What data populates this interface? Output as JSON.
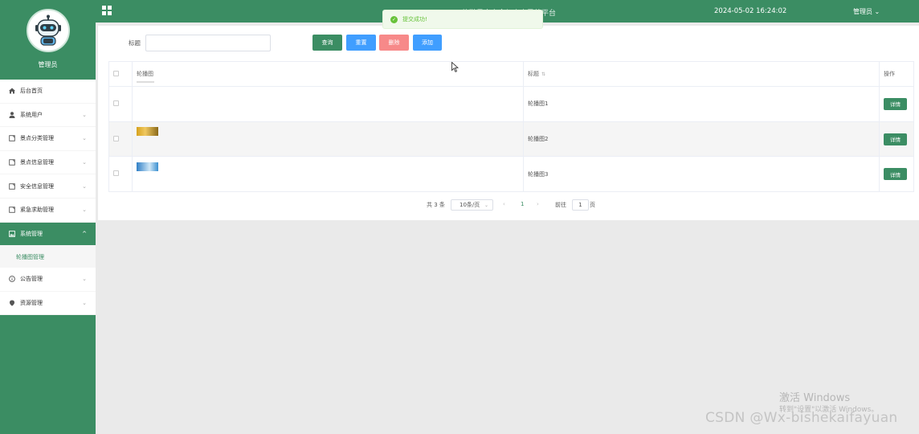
{
  "sidebar": {
    "role": "管理员",
    "items": [
      {
        "label": "后台首页",
        "icon": "home-icon",
        "active": false
      },
      {
        "label": "系统用户",
        "icon": "user-icon",
        "active": false
      },
      {
        "label": "景点分类管理",
        "icon": "doc-icon",
        "active": false
      },
      {
        "label": "景点信息管理",
        "icon": "doc-icon",
        "active": false
      },
      {
        "label": "安全信息管理",
        "icon": "doc-icon",
        "active": false
      },
      {
        "label": "紧急求助管理",
        "icon": "doc-icon",
        "active": false
      },
      {
        "label": "系统管理",
        "icon": "picture-icon",
        "active": true
      },
      {
        "label": "公告管理",
        "icon": "info-icon",
        "active": false
      },
      {
        "label": "资源管理",
        "icon": "location-icon",
        "active": false
      }
    ],
    "submenu": {
      "label": "轮播图管理"
    }
  },
  "header": {
    "title": "旅游景点安全与个人导航平台",
    "datetime": "2024-05-02 16:24:02",
    "user": "管理员"
  },
  "toast": {
    "message": "提交成功!"
  },
  "search": {
    "label": "标题",
    "placeholder": ""
  },
  "toolbar": {
    "query": "查询",
    "reset": "重置",
    "delete": "删除",
    "add": "添加"
  },
  "table": {
    "headers": {
      "image": "轮播图",
      "title": "标题",
      "action": "操作"
    },
    "rows": [
      {
        "title": "轮播图1",
        "action": "详情"
      },
      {
        "title": "轮播图2",
        "action": "详情"
      },
      {
        "title": "轮播图3",
        "action": "详情"
      }
    ]
  },
  "pagination": {
    "total": "共 3 条",
    "page_size": "10条/页",
    "current": "1",
    "goto_label": "前往",
    "goto_value": "1",
    "page_suffix": "页"
  },
  "watermark": {
    "activate_title": "激活 Windows",
    "activate_hint": "转到\"设置\"以激活 Windows。",
    "csdn": "CSDN @Wx-bishekaifayuan"
  },
  "colors": {
    "brand": "#3b8d63",
    "reset": "#409eff",
    "delete": "#f78989",
    "toast_bg": "#f0f9eb",
    "toast_text": "#67c23a"
  }
}
